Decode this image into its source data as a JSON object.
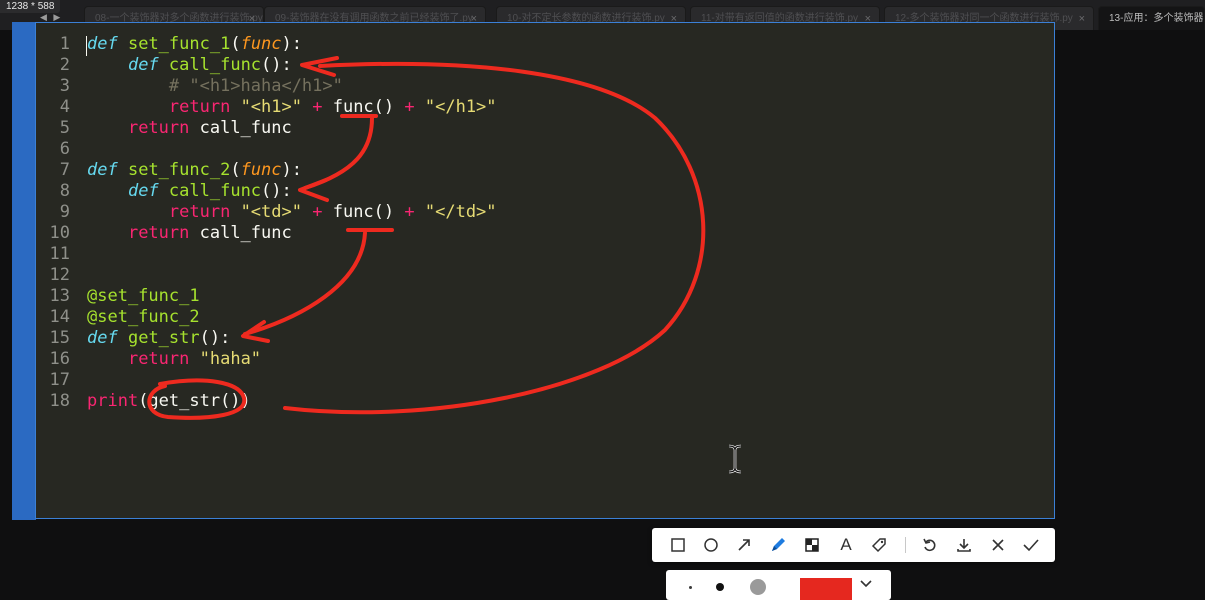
{
  "window": {
    "size_label": "1238 * 588"
  },
  "tabs": [
    {
      "label": "08-一个装饰器对多个函数进行装饰.py",
      "close": "×",
      "active": false
    },
    {
      "label": "09-装饰器在没有调用函数之前已经装饰了.py",
      "close": "×",
      "active": false
    },
    {
      "label": "10-对不定长参数的函数进行装饰.py",
      "close": "×",
      "active": false
    },
    {
      "label": "11-对带有返回值的函数进行装饰.py",
      "close": "×",
      "active": false
    },
    {
      "label": "12-多个装饰器对同一个函数进行装饰.py",
      "close": "×",
      "active": false
    },
    {
      "label": "13-应用：多个装饰器对",
      "close": "",
      "active": true
    }
  ],
  "nav": {
    "arrows": "◀ ▶"
  },
  "editor": {
    "lines": [
      {
        "n": "1",
        "tokens": [
          [
            "kw",
            "def"
          ],
          [
            "txt",
            " "
          ],
          [
            "fn",
            "set_func_1"
          ],
          [
            "txt",
            "("
          ],
          [
            "prm",
            "func"
          ],
          [
            "txt",
            "):"
          ]
        ]
      },
      {
        "n": "2",
        "tokens": [
          [
            "txt",
            "    "
          ],
          [
            "kw",
            "def"
          ],
          [
            "txt",
            " "
          ],
          [
            "fn",
            "call_func"
          ],
          [
            "txt",
            "():"
          ]
        ]
      },
      {
        "n": "3",
        "tokens": [
          [
            "cmt",
            "        # \"<h1>haha</h1>\""
          ]
        ]
      },
      {
        "n": "4",
        "tokens": [
          [
            "txt",
            "        "
          ],
          [
            "op",
            "return"
          ],
          [
            "txt",
            " "
          ],
          [
            "str",
            "\"<h1>\""
          ],
          [
            "txt",
            " "
          ],
          [
            "op",
            "+"
          ],
          [
            "txt",
            " func() "
          ],
          [
            "op",
            "+"
          ],
          [
            "txt",
            " "
          ],
          [
            "str",
            "\"</h1>\""
          ]
        ]
      },
      {
        "n": "5",
        "tokens": [
          [
            "txt",
            "    "
          ],
          [
            "op",
            "return"
          ],
          [
            "txt",
            " call_func"
          ]
        ]
      },
      {
        "n": "6",
        "tokens": []
      },
      {
        "n": "7",
        "tokens": [
          [
            "kw",
            "def"
          ],
          [
            "txt",
            " "
          ],
          [
            "fn",
            "set_func_2"
          ],
          [
            "txt",
            "("
          ],
          [
            "prm",
            "func"
          ],
          [
            "txt",
            "):"
          ]
        ]
      },
      {
        "n": "8",
        "tokens": [
          [
            "txt",
            "    "
          ],
          [
            "kw",
            "def"
          ],
          [
            "txt",
            " "
          ],
          [
            "fn",
            "call_func"
          ],
          [
            "txt",
            "():"
          ]
        ]
      },
      {
        "n": "9",
        "tokens": [
          [
            "txt",
            "        "
          ],
          [
            "op",
            "return"
          ],
          [
            "txt",
            " "
          ],
          [
            "str",
            "\"<td>\""
          ],
          [
            "txt",
            " "
          ],
          [
            "op",
            "+"
          ],
          [
            "txt",
            " func() "
          ],
          [
            "op",
            "+"
          ],
          [
            "txt",
            " "
          ],
          [
            "str",
            "\"</td>\""
          ]
        ]
      },
      {
        "n": "10",
        "tokens": [
          [
            "txt",
            "    "
          ],
          [
            "op",
            "return"
          ],
          [
            "txt",
            " call_func"
          ]
        ]
      },
      {
        "n": "11",
        "tokens": []
      },
      {
        "n": "12",
        "tokens": []
      },
      {
        "n": "13",
        "tokens": [
          [
            "deco",
            "@set_func_1"
          ]
        ]
      },
      {
        "n": "14",
        "tokens": [
          [
            "deco",
            "@set_func_2"
          ]
        ]
      },
      {
        "n": "15",
        "tokens": [
          [
            "kw",
            "def"
          ],
          [
            "txt",
            " "
          ],
          [
            "fn",
            "get_str"
          ],
          [
            "txt",
            "():"
          ]
        ]
      },
      {
        "n": "16",
        "tokens": [
          [
            "txt",
            "    "
          ],
          [
            "op",
            "return"
          ],
          [
            "txt",
            " "
          ],
          [
            "str",
            "\"haha\""
          ]
        ]
      },
      {
        "n": "17",
        "tokens": []
      },
      {
        "n": "18",
        "tokens": [
          [
            "op",
            "print"
          ],
          [
            "txt",
            "(get_str())"
          ]
        ]
      }
    ]
  },
  "toolbar": {
    "tools": [
      {
        "name": "rectangle-tool-icon"
      },
      {
        "name": "ellipse-tool-icon"
      },
      {
        "name": "arrow-tool-icon"
      },
      {
        "name": "pen-tool-icon"
      },
      {
        "name": "mosaic-tool-icon"
      },
      {
        "name": "text-tool-icon",
        "glyph": "A"
      },
      {
        "name": "tag-tool-icon"
      },
      {
        "name": "undo-icon"
      },
      {
        "name": "download-icon"
      },
      {
        "name": "cancel-icon"
      },
      {
        "name": "confirm-icon"
      }
    ],
    "active_tool": "pen-tool-icon"
  },
  "colors": {
    "annotation": "#ee2a1f",
    "selected_color": "#e5281f",
    "accent": "#1e7ce0"
  }
}
